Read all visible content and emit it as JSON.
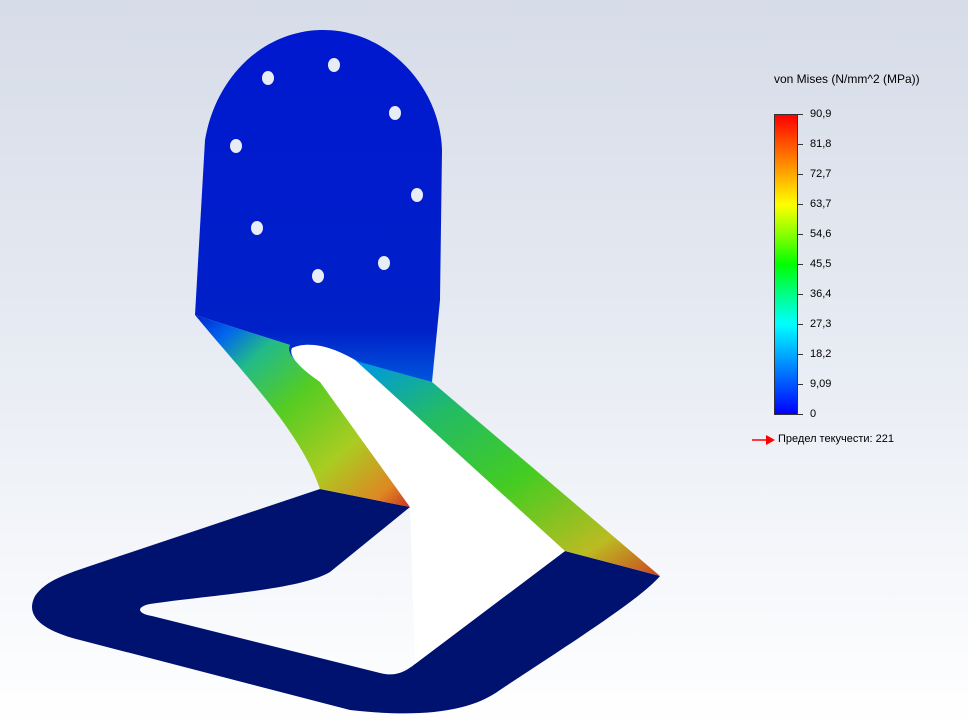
{
  "legend": {
    "title": "von Mises (N/mm^2 (MPa))",
    "ticks": [
      "90,9",
      "81,8",
      "72,7",
      "63,7",
      "54,6",
      "45,5",
      "36,4",
      "27,3",
      "18,2",
      "9,09",
      "0"
    ],
    "yield_label": "Предел текучести: 221",
    "yield_arrow_color": "#ff0000"
  },
  "colors": {
    "max_stress": "#ff0000",
    "min_stress": "#0000ff",
    "background_top": "#d6dce8",
    "background_bottom": "#ffffff"
  },
  "model": {
    "name": "bent-sheet-bracket",
    "mount_hole_count": 8
  }
}
